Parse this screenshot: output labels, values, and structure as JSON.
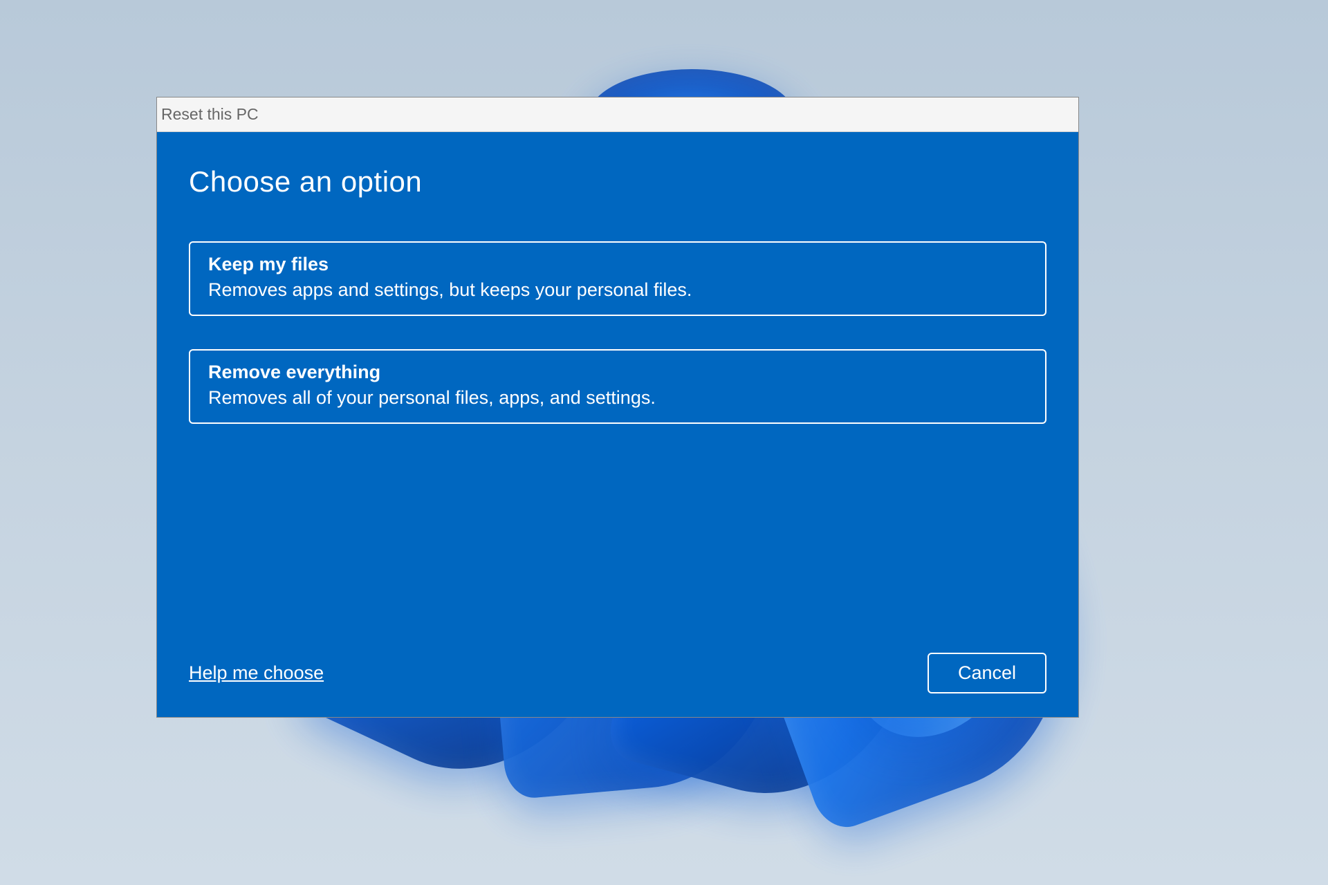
{
  "window": {
    "title": "Reset this PC"
  },
  "heading": "Choose an option",
  "options": [
    {
      "title": "Keep my files",
      "description": "Removes apps and settings, but keeps your personal files."
    },
    {
      "title": "Remove everything",
      "description": "Removes all of your personal files, apps, and settings."
    }
  ],
  "footer": {
    "help_link": "Help me choose",
    "cancel_label": "Cancel"
  },
  "colors": {
    "panel_bg": "#0067c0",
    "titlebar_bg": "#f5f5f5",
    "titlebar_text": "#666666"
  }
}
